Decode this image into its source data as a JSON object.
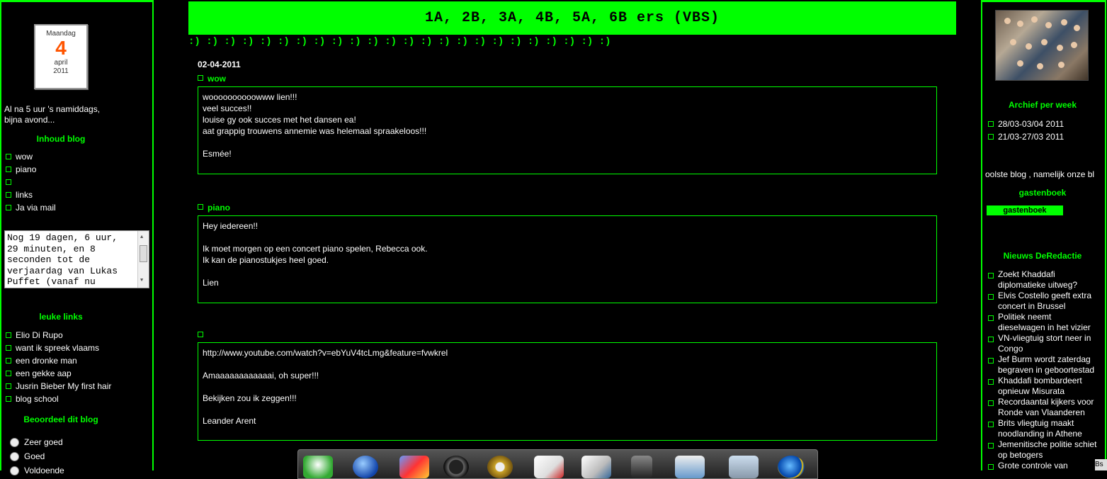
{
  "left": {
    "calendar": {
      "weekday": "Maandag",
      "day": "4",
      "month": "april",
      "year": "2011"
    },
    "time_text_1": "Al na 5 uur 's namiddags,",
    "time_text_2": "bijna avond...",
    "contents_heading": "Inhoud blog",
    "contents": [
      "wow",
      "piano",
      "",
      "links",
      "Ja via mail"
    ],
    "countdown_lines": [
      "Nog 19 dagen, 6 uur,",
      "29 minuten, en 8",
      "seconden tot de",
      "verjaardag van Lukas",
      "Puffet (vanaf nu"
    ],
    "links_heading": "leuke links",
    "links": [
      "Elio Di Rupo",
      "want ik spreek vlaams",
      "een dronke man",
      "een gekke aap",
      "Jusrin Bieber My first hair",
      "blog school"
    ],
    "rating_heading": "Beoordeel dit blog",
    "ratings": [
      "Zeer goed",
      "Goed",
      "Voldoende"
    ]
  },
  "center": {
    "banner": "1A, 2B, 3A, 4B, 5A, 6B ers (VBS)",
    "smileys": ":) :) :) :) :) :) :) :) :) :) :) :) :) :) :) :) :) :) :) :) :) :) :) :)",
    "date": "02-04-2011",
    "posts": [
      {
        "title": "wow",
        "lines": [
          "woooooooooowww lien!!!",
          "veel succes!!",
          "louise gy ook succes met het dansen ea!",
          "aat grappig trouwens annemie was helemaal spraakeloos!!!",
          "",
          "Esmée!"
        ]
      },
      {
        "title": "piano",
        "lines": [
          "Hey iedereen!!",
          "",
          "Ik moet morgen op een concert piano spelen, Rebecca ook.",
          "Ik kan de pianostukjes heel goed.",
          "",
          "Lien"
        ]
      },
      {
        "title": "",
        "lines": [
          "http://www.youtube.com/watch?v=ebYuV4tcLmg&feature=fvwkrel",
          "",
          "Amaaaaaaaaaaaai, oh super!!!",
          "",
          "Bekijken zou ik zeggen!!!",
          "",
          "Leander Arent"
        ]
      }
    ]
  },
  "right": {
    "archive_heading": "Archief per week",
    "archive": [
      "28/03-03/04 2011",
      "21/03-27/03 2011"
    ],
    "scroll_text": "oolste blog , namelijk onze bl",
    "guestbook_heading": "gastenboek",
    "guestbook_button": "gastenboek",
    "news_heading": "Nieuws DeRedactie",
    "news": [
      "Zoekt Khaddafi diplomatieke uitweg?",
      "Elvis Costello geeft extra concert in Brussel",
      "Politiek neemt dieselwagen in het vizier",
      "VN-vliegtuig stort neer in Congo",
      "Jef Burm wordt zaterdag begraven in geboortestad",
      "Khaddafi bombardeert opnieuw Misurata",
      "Recordaantal kijkers voor Ronde van Vlaanderen",
      "Brits vliegtuig maakt noodlanding in Athene",
      "Jemenitische politie schiet op betogers",
      "Grote controle van"
    ]
  },
  "corner_label": "Bs",
  "colors": {
    "accent": "#00ff00",
    "background": "#000000"
  }
}
